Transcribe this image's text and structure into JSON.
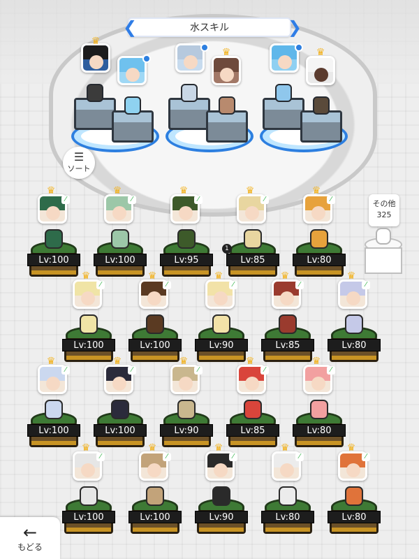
{
  "header": {
    "title": "水スキル"
  },
  "sort_button": {
    "label": "ソート"
  },
  "other": {
    "label": "その他",
    "count": "325"
  },
  "extra_badge": {
    "text": "1"
  },
  "back_button": {
    "label": "もどる"
  },
  "roster_rows": [
    [
      "Lv:100",
      "Lv:100",
      "Lv:95",
      "Lv:85",
      "Lv:80"
    ],
    [
      "Lv:100",
      "Lv:100",
      "Lv:90",
      "Lv:85",
      "Lv:80"
    ],
    [
      "Lv:100",
      "Lv:100",
      "Lv:90",
      "Lv:85",
      "Lv:80"
    ],
    [
      "Lv:100",
      "Lv:100",
      "Lv:90",
      "Lv:80",
      "Lv:80"
    ]
  ],
  "colors": {
    "accent": "#2d7fe0",
    "crown": "#f2b21f",
    "pedestal_green": "#3e7a35",
    "pedestal_brown": "#6b5028"
  }
}
